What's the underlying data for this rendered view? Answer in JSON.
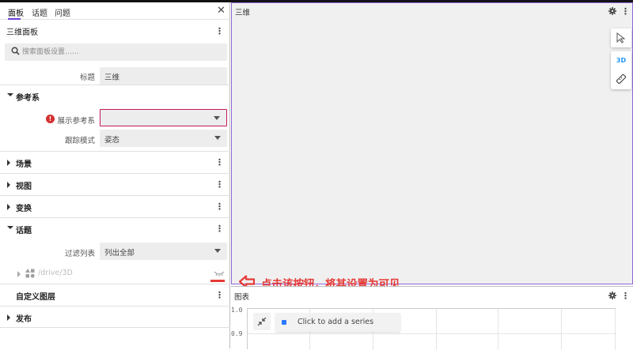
{
  "left_panel": {
    "tabs": [
      {
        "label": "面板"
      },
      {
        "label": "话题"
      },
      {
        "label": "问题"
      }
    ],
    "panel_title": "三维面板",
    "search_placeholder": "搜索面板设置……",
    "title_label": "标题",
    "title_value": "三维",
    "sections": {
      "reference": {
        "label": "参考系",
        "display_frame_label": "展示参考系",
        "display_frame_value": "",
        "follow_mode_label": "跟踪模式",
        "follow_mode_value": "姿态"
      },
      "scene": "场景",
      "view": "视图",
      "transforms": "变换",
      "topics": {
        "label": "话题",
        "filter_label": "过滤列表",
        "filter_value": "列出全部",
        "item_path": "/drive/3D"
      },
      "custom_layers": "自定义图层",
      "publish": "发布"
    }
  },
  "viewport_panel": {
    "title": "三维",
    "mode_3d": "3D"
  },
  "chart_panel": {
    "title": "图表",
    "add_series": "Click to add a series",
    "y_ticks": [
      "1.0",
      "0.9"
    ]
  },
  "annotation": {
    "text": "点击该按钮，将其设置为可见",
    "color": "#e53935"
  },
  "colors": {
    "accent": "#6c3fd8",
    "error": "#d32f2f",
    "link_blue": "#2196f3"
  }
}
